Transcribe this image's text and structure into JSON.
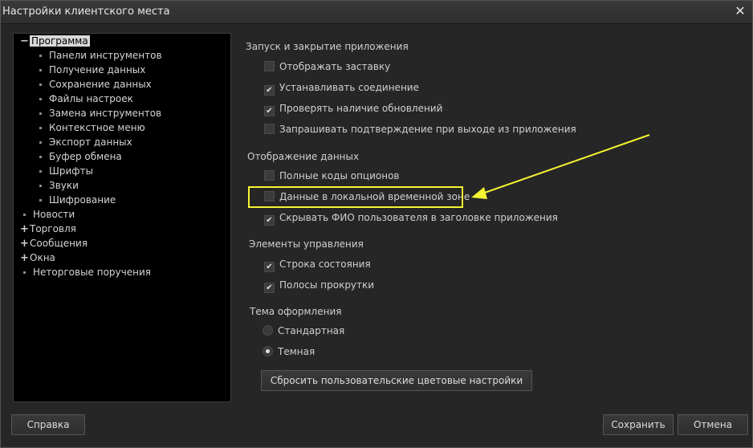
{
  "window": {
    "title": "Настройки клиентского места",
    "close_icon": "close-icon"
  },
  "tree": {
    "items": [
      {
        "label": "Программа",
        "kind": "collapse",
        "selected": true
      },
      {
        "label": "Панели инструментов",
        "kind": "leaf"
      },
      {
        "label": "Получение данных",
        "kind": "leaf"
      },
      {
        "label": "Сохранение данных",
        "kind": "leaf"
      },
      {
        "label": "Файлы настроек",
        "kind": "leaf"
      },
      {
        "label": "Замена инструментов",
        "kind": "leaf"
      },
      {
        "label": "Контекстное меню",
        "kind": "leaf"
      },
      {
        "label": "Экспорт данных",
        "kind": "leaf"
      },
      {
        "label": "Буфер обмена",
        "kind": "leaf"
      },
      {
        "label": "Шрифты",
        "kind": "leaf"
      },
      {
        "label": "Звуки",
        "kind": "leaf"
      },
      {
        "label": "Шифрование",
        "kind": "leaf"
      },
      {
        "label": "Новости",
        "kind": "root-leaf"
      },
      {
        "label": "Торговля",
        "kind": "expand"
      },
      {
        "label": "Сообщения",
        "kind": "expand"
      },
      {
        "label": "Окна",
        "kind": "expand"
      },
      {
        "label": "Неторговые поручения",
        "kind": "root-leaf"
      }
    ]
  },
  "settings": {
    "launch": {
      "title": "Запуск и закрытие приложения",
      "options": [
        {
          "label": "Отображать заставку",
          "checked": false
        },
        {
          "label": "Устанавливать соединение",
          "checked": true
        },
        {
          "label": "Проверять наличие обновлений",
          "checked": true
        },
        {
          "label": "Запрашивать подтверждение при выходе из приложения",
          "checked": false
        }
      ]
    },
    "display": {
      "title": "Отображение данных",
      "options": [
        {
          "label": "Полные коды опционов",
          "checked": false
        },
        {
          "label": "Данные в локальной временной зоне",
          "checked": false
        },
        {
          "label": "Скрывать ФИО пользователя в заголовке приложения",
          "checked": true
        }
      ]
    },
    "controls": {
      "title": "Элементы управления",
      "options": [
        {
          "label": "Строка состояния",
          "checked": true
        },
        {
          "label": "Полосы прокрутки",
          "checked": true
        }
      ]
    },
    "theme": {
      "title": "Тема оформления",
      "options": [
        {
          "label": "Стандартная",
          "selected": false
        },
        {
          "label": "Темная",
          "selected": true
        }
      ],
      "reset_label": "Сбросить пользовательские цветовые настройки"
    }
  },
  "footer": {
    "help_label": "Справка",
    "save_label": "Сохранить",
    "cancel_label": "Отмена"
  },
  "colors": {
    "highlight": "#f5f532",
    "background": "#262626"
  }
}
